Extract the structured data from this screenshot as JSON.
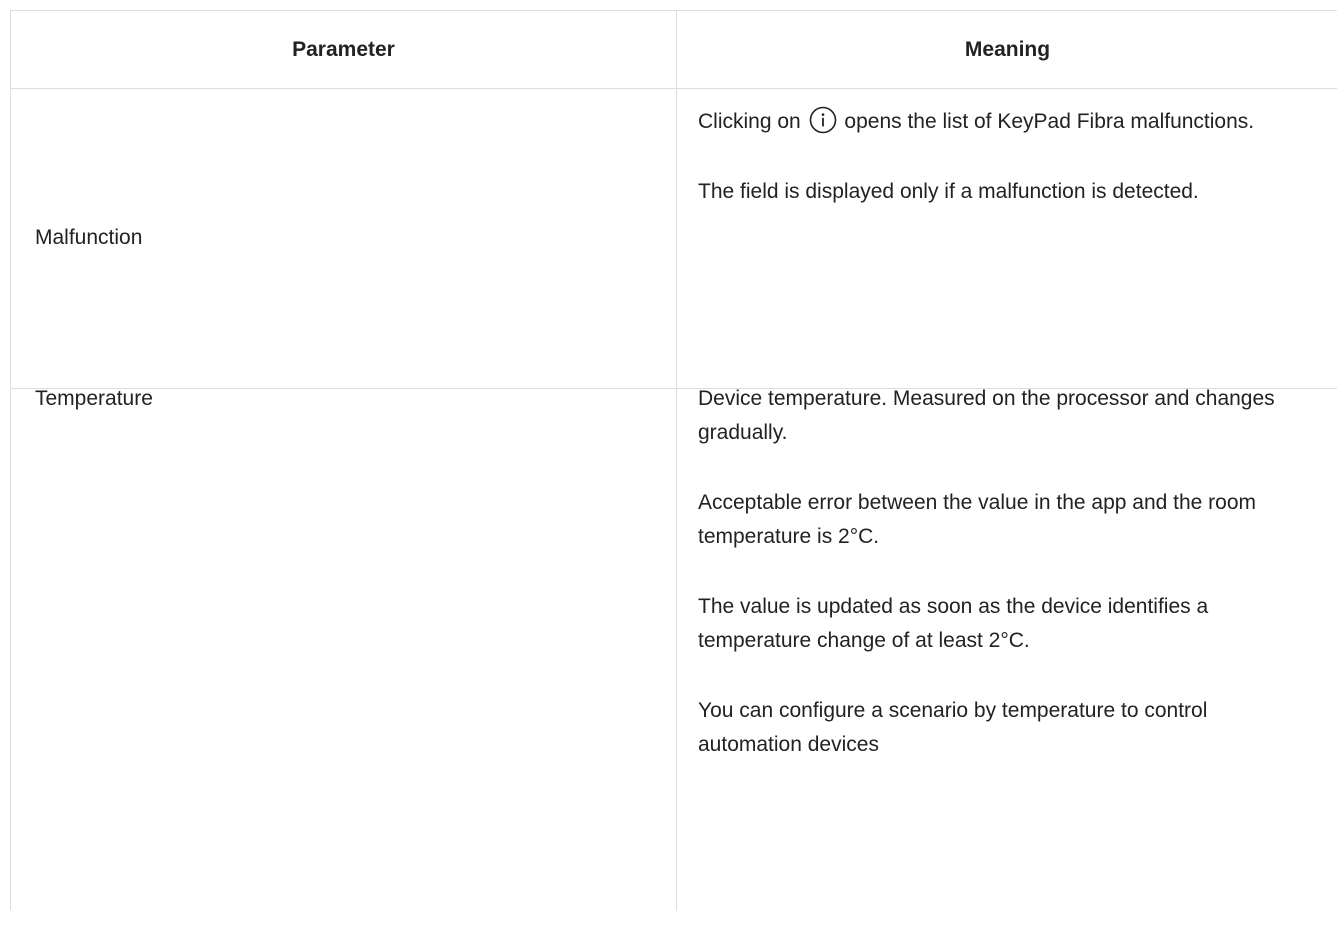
{
  "table": {
    "headers": {
      "parameter": "Parameter",
      "meaning": "Meaning"
    },
    "rows": [
      {
        "parameter": "Malfunction",
        "meaning": {
          "p1_before_icon": "Clicking on",
          "p1_icon": "info-circle-icon",
          "p1_after_icon": "opens the list of KeyPad Fibra malfunctions.",
          "p2": "The field is displayed only if a malfunction is detected."
        }
      },
      {
        "parameter": "Temperature",
        "meaning": {
          "p1": "Device temperature. Measured on the processor and changes gradually.",
          "p2": "Acceptable error between the value in the app and the room temperature is 2°C.",
          "p3": "The value is updated as soon as the device identifies a temperature change of at least 2°C.",
          "p4": "You can configure a scenario by temperature to control automation devices"
        }
      }
    ]
  },
  "colors": {
    "text": "#222222",
    "border": "#dddddd",
    "background": "#ffffff"
  }
}
